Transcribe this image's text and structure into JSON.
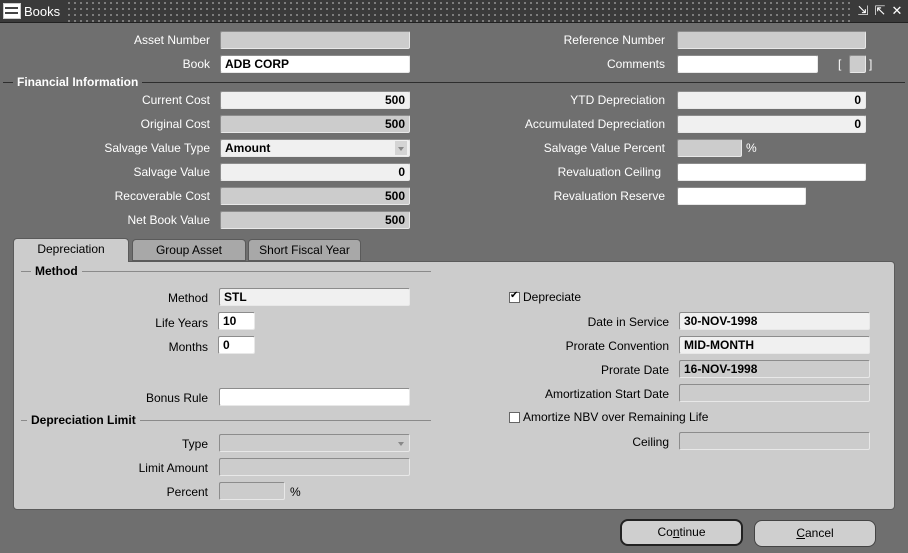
{
  "window": {
    "title": "Books",
    "controls": [
      "minimize-icon",
      "maximize-icon",
      "close-icon"
    ]
  },
  "header": {
    "asset_number": {
      "label": "Asset Number",
      "value": ""
    },
    "book": {
      "label": "Book",
      "value": "ADB CORP"
    },
    "reference_number": {
      "label": "Reference Number",
      "value": ""
    },
    "comments": {
      "label": "Comments",
      "value": "",
      "bracket_open": "[",
      "bracket_close": "]"
    }
  },
  "financial": {
    "section_title": "Financial Information",
    "current_cost": {
      "label": "Current Cost",
      "value": "500"
    },
    "original_cost": {
      "label": "Original Cost",
      "value": "500"
    },
    "salvage_value_type": {
      "label": "Salvage Value Type",
      "value": "Amount"
    },
    "salvage_value": {
      "label": "Salvage Value",
      "value": "0"
    },
    "recoverable_cost": {
      "label": "Recoverable Cost",
      "value": "500"
    },
    "net_book_value": {
      "label": "Net Book Value",
      "value": "500"
    },
    "ytd_depreciation": {
      "label": "YTD Depreciation",
      "value": "0"
    },
    "accumulated_depreciation": {
      "label": "Accumulated Depreciation",
      "value": "0"
    },
    "salvage_value_percent": {
      "label": "Salvage Value Percent",
      "value": "",
      "unit": "%"
    },
    "revaluation_ceiling": {
      "label": "Revaluation Ceiling",
      "value": ""
    },
    "revaluation_reserve": {
      "label": "Revaluation Reserve",
      "value": ""
    }
  },
  "tabs": [
    {
      "label": "Depreciation",
      "active": true
    },
    {
      "label": "Group Asset",
      "active": false
    },
    {
      "label": "Short Fiscal Year",
      "active": false
    }
  ],
  "depreciation": {
    "method_section": "Method",
    "method": {
      "label": "Method",
      "value": "STL"
    },
    "life_years": {
      "label": "Life Years",
      "value": "10"
    },
    "months": {
      "label": "Months",
      "value": "0"
    },
    "bonus_rule": {
      "label": "Bonus Rule",
      "value": ""
    },
    "depreciate": {
      "label": "Depreciate",
      "checked": true
    },
    "date_in_service": {
      "label": "Date in Service",
      "value": "30-NOV-1998"
    },
    "prorate_convention": {
      "label": "Prorate Convention",
      "value": "MID-MONTH"
    },
    "prorate_date": {
      "label": "Prorate Date",
      "value": "16-NOV-1998"
    },
    "amortization_start_date": {
      "label": "Amortization Start Date",
      "value": ""
    },
    "amortize_nbv": {
      "label": "Amortize NBV over Remaining Life",
      "checked": false
    },
    "ceiling": {
      "label": "Ceiling",
      "value": ""
    },
    "limit_section": "Depreciation Limit",
    "type": {
      "label": "Type",
      "value": ""
    },
    "limit_amount": {
      "label": "Limit Amount",
      "value": ""
    },
    "percent": {
      "label": "Percent",
      "value": "",
      "unit": "%"
    }
  },
  "buttons": {
    "continue": {
      "pre": "Co",
      "mnemonic": "n",
      "post": "tinue"
    },
    "cancel": {
      "pre": "",
      "mnemonic": "C",
      "post": "ancel"
    }
  }
}
